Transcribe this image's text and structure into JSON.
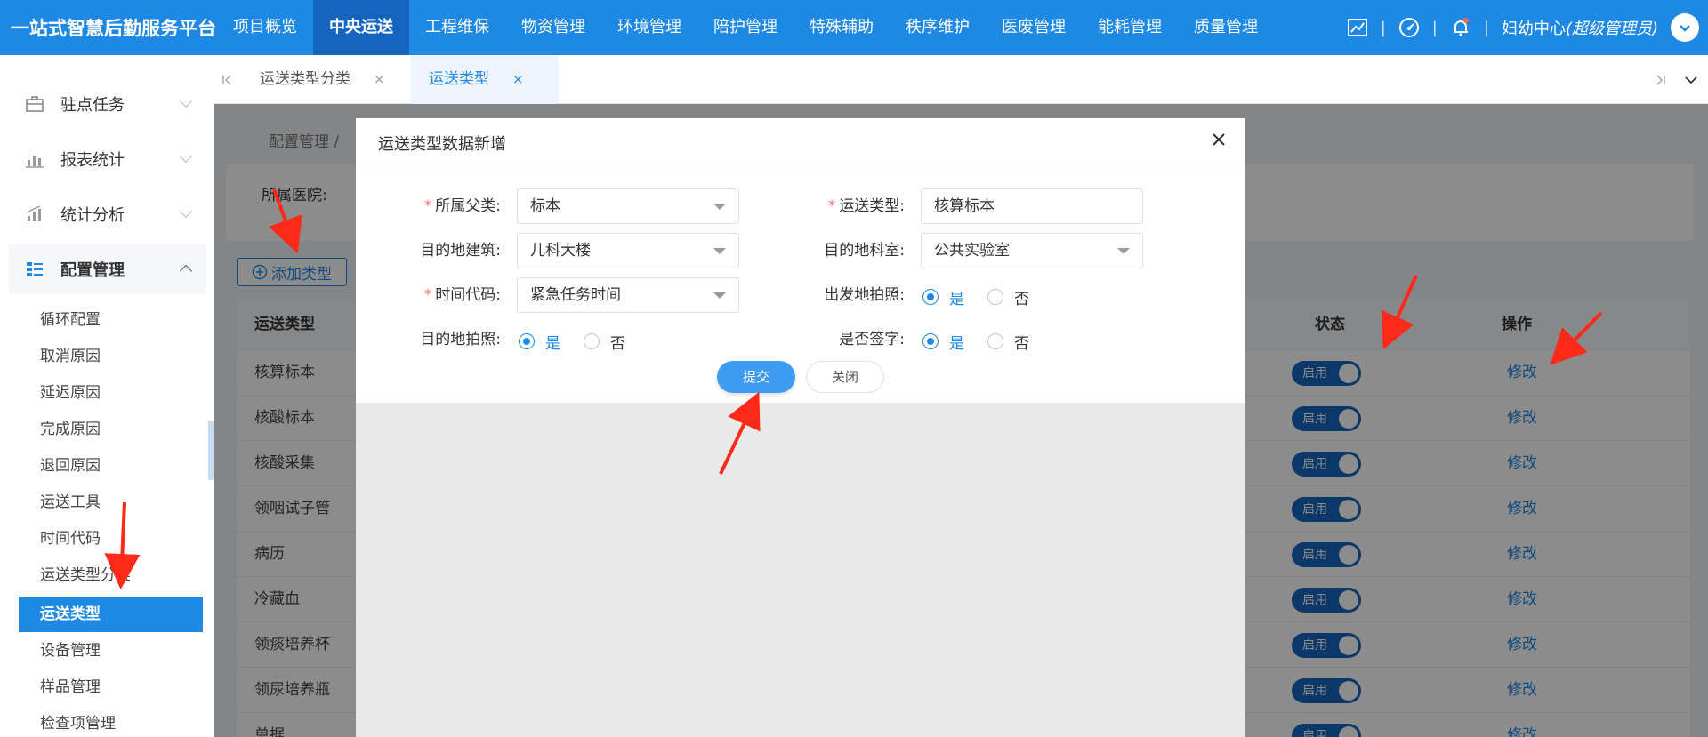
{
  "app": {
    "title": "一站式智慧后勤服务平台"
  },
  "topnav": [
    {
      "label": "项目概览",
      "active": false
    },
    {
      "label": "中央运送",
      "active": true
    },
    {
      "label": "工程维保",
      "active": false
    },
    {
      "label": "物资管理",
      "active": false
    },
    {
      "label": "环境管理",
      "active": false
    },
    {
      "label": "陪护管理",
      "active": false
    },
    {
      "label": "特殊辅助",
      "active": false
    },
    {
      "label": "秩序维护",
      "active": false
    },
    {
      "label": "医废管理",
      "active": false
    },
    {
      "label": "能耗管理",
      "active": false
    },
    {
      "label": "质量管理",
      "active": false
    }
  ],
  "header": {
    "org": "妇幼中心",
    "role": "(超级管理员)",
    "separator": "|"
  },
  "sidebar": {
    "groups": [
      {
        "label": "驻点任务",
        "icon": "briefcase-icon"
      },
      {
        "label": "报表统计",
        "icon": "bar-chart-icon"
      },
      {
        "label": "统计分析",
        "icon": "analysis-chart-icon"
      },
      {
        "label": "配置管理",
        "icon": "config-list-icon"
      }
    ],
    "items": [
      "循环配置",
      "取消原因",
      "延迟原因",
      "完成原因",
      "退回原因",
      "运送工具",
      "时间代码",
      "运送类型分类",
      "运送类型",
      "设备管理",
      "样品管理",
      "检查项管理"
    ],
    "active_item": "运送类型"
  },
  "tabs": [
    {
      "label": "运送类型分类",
      "close": "×"
    },
    {
      "label": "运送类型",
      "close": "×"
    }
  ],
  "page": {
    "breadcrumb": "配置管理  /",
    "filter_label": "所属医院:",
    "add_button": "添加类型",
    "table": {
      "headers": {
        "type": "运送类型",
        "status": "状态",
        "action": "操作"
      },
      "rows": [
        {
          "type": "核算标本",
          "status": "启用",
          "action": "修改"
        },
        {
          "type": "核酸标本",
          "status": "启用",
          "action": "修改"
        },
        {
          "type": "核酸采集",
          "status": "启用",
          "action": "修改"
        },
        {
          "type": "领咽试子管",
          "status": "启用",
          "action": "修改"
        },
        {
          "type": "病历",
          "status": "启用",
          "action": "修改"
        },
        {
          "type": "冷藏血",
          "status": "启用",
          "action": "修改"
        },
        {
          "type": "领痰培养杯",
          "status": "启用",
          "action": "修改"
        },
        {
          "type": "领尿培养瓶",
          "status": "启用",
          "action": "修改"
        },
        {
          "type": "单据",
          "status": "启用",
          "action": "修改"
        }
      ]
    }
  },
  "modal": {
    "title": "运送类型数据新增",
    "fields": {
      "parent": {
        "label": "所属父类:",
        "value": "标本",
        "required": true
      },
      "transport_type": {
        "label": "运送类型:",
        "value": "核算标本",
        "required": true
      },
      "building": {
        "label": "目的地建筑:",
        "value": "儿科大楼"
      },
      "department": {
        "label": "目的地科室:",
        "value": "公共实验室"
      },
      "time_code": {
        "label": "时间代码:",
        "value": "紧急任务时间",
        "required": true
      },
      "origin_photo": {
        "label": "出发地拍照:",
        "yes": "是",
        "no": "否",
        "selected": "是"
      },
      "dest_photo": {
        "label": "目的地拍照:",
        "yes": "是",
        "no": "否",
        "selected": "是"
      },
      "signature": {
        "label": "是否签字:",
        "yes": "是",
        "no": "否",
        "selected": "是"
      }
    },
    "required_mark": "*",
    "submit": "提交",
    "close": "关闭"
  },
  "colors": {
    "primary": "#1e88e5",
    "nav_active": "#1565c0",
    "annotation_arrow": "#ff2a1a",
    "required": "#f56c6c"
  }
}
